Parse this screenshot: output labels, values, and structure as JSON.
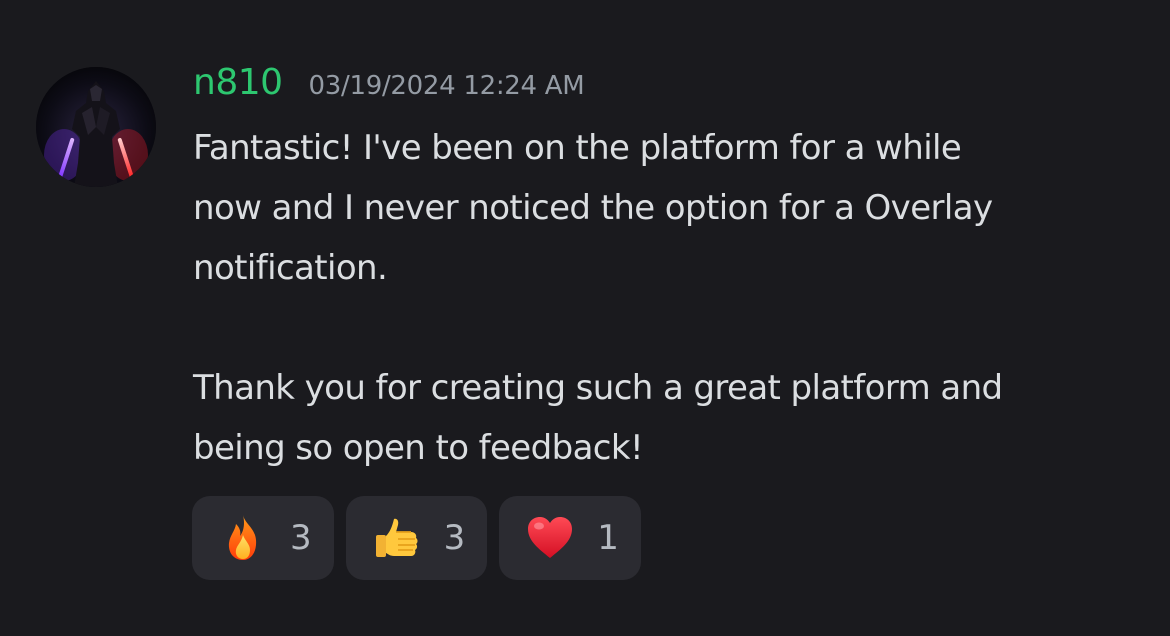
{
  "message": {
    "author": "n810",
    "timestamp": "03/19/2024 12:24 AM",
    "paragraphs": [
      "Fantastic! I've been on the platform for a while\nnow and I never noticed the option for a Overlay\nnotification.",
      "Thank you for creating such a great platform and\nbeing so open to feedback!"
    ],
    "author_color": "#2dc770"
  },
  "reactions": [
    {
      "icon": "fire-emoji-icon",
      "count": "3"
    },
    {
      "icon": "thumbs-up-emoji-icon",
      "count": "3"
    },
    {
      "icon": "red-heart-emoji-icon",
      "count": "1"
    }
  ]
}
